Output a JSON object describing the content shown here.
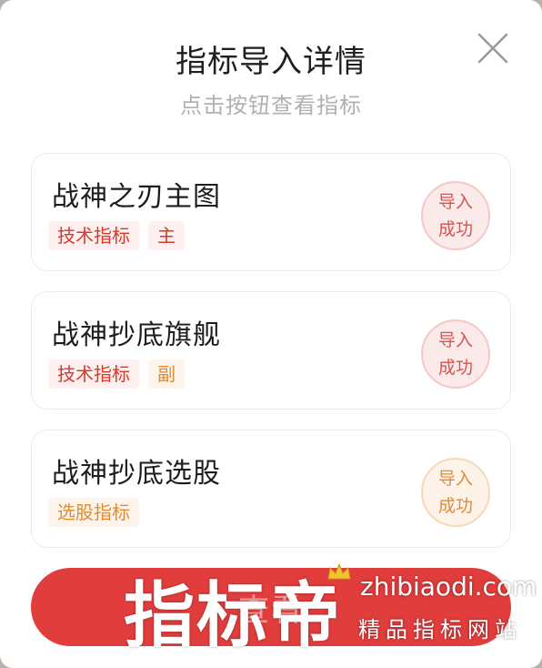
{
  "dialog": {
    "title": "指标导入详情",
    "subtitle": "点击按钮查看指标",
    "close_icon": "close-icon"
  },
  "cards": [
    {
      "name": "战神之刃主图",
      "tags": [
        {
          "text": "技术指标",
          "color": "red"
        },
        {
          "text": "主",
          "color": "red"
        }
      ],
      "status": [
        "导入",
        "成功"
      ],
      "status_color": "red"
    },
    {
      "name": "战神抄底旗舰",
      "tags": [
        {
          "text": "技术指标",
          "color": "red"
        },
        {
          "text": "副",
          "color": "orange"
        }
      ],
      "status": [
        "导入",
        "成功"
      ],
      "status_color": "red"
    },
    {
      "name": "战神抄底选股",
      "tags": [
        {
          "text": "选股指标",
          "color": "orange"
        }
      ],
      "status": [
        "导入",
        "成功"
      ],
      "status_color": "orange"
    }
  ],
  "primary_button": {
    "label": "查看"
  },
  "watermark": {
    "brand": "指标帝",
    "domain": "zhibiaodi.com",
    "slogan": "精品指标网站"
  },
  "colors": {
    "accent": "#e23d3d",
    "tag_red": "#d9382e",
    "tag_orange": "#e48a2e"
  }
}
